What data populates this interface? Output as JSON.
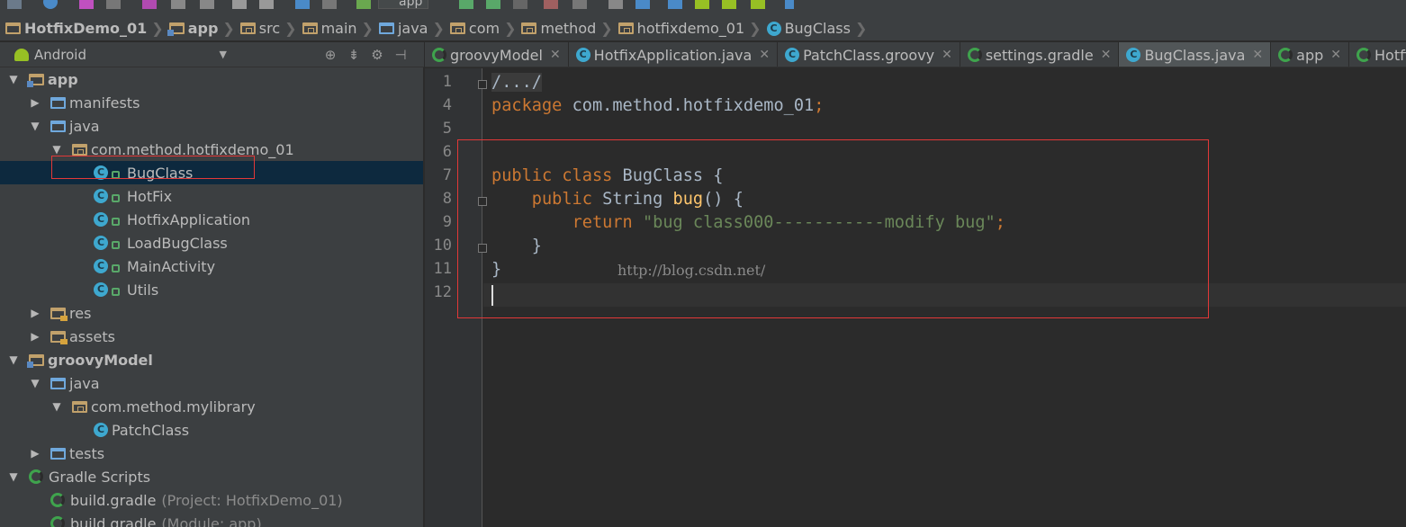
{
  "toolbar": {
    "run_config": "app"
  },
  "breadcrumbs": [
    "HotfixDemo_01",
    "app",
    "src",
    "main",
    "java",
    "com",
    "method",
    "hotfixdemo_01",
    "BugClass"
  ],
  "project_panel": {
    "view_selector": "Android",
    "tree": [
      {
        "label": "app",
        "indent": 0,
        "arrow": "down",
        "icon": "module",
        "bold": true
      },
      {
        "label": "manifests",
        "indent": 1,
        "arrow": "right",
        "icon": "folder-blue"
      },
      {
        "label": "java",
        "indent": 1,
        "arrow": "down",
        "icon": "folder-blue"
      },
      {
        "label": "com.method.hotfixdemo_01",
        "indent": 2,
        "arrow": "down",
        "icon": "package"
      },
      {
        "label": "BugClass",
        "indent": 3,
        "icon": "class",
        "selected": true
      },
      {
        "label": "HotFix",
        "indent": 3,
        "icon": "class"
      },
      {
        "label": "HotfixApplication",
        "indent": 3,
        "icon": "class"
      },
      {
        "label": "LoadBugClass",
        "indent": 3,
        "icon": "class"
      },
      {
        "label": "MainActivity",
        "indent": 3,
        "icon": "class"
      },
      {
        "label": "Utils",
        "indent": 3,
        "icon": "class"
      },
      {
        "label": "res",
        "indent": 1,
        "arrow": "right",
        "icon": "res"
      },
      {
        "label": "assets",
        "indent": 1,
        "arrow": "right",
        "icon": "res"
      },
      {
        "label": "groovyModel",
        "indent": 0,
        "arrow": "down",
        "icon": "module",
        "bold": true
      },
      {
        "label": "java",
        "indent": 1,
        "arrow": "down",
        "icon": "folder-blue"
      },
      {
        "label": "com.method.mylibrary",
        "indent": 2,
        "arrow": "down",
        "icon": "package"
      },
      {
        "label": "PatchClass",
        "indent": 3,
        "icon": "class-plain"
      },
      {
        "label": "tests",
        "indent": 1,
        "arrow": "right",
        "icon": "folder-blue"
      },
      {
        "label": "Gradle Scripts",
        "indent": 0,
        "arrow": "down",
        "icon": "gradle"
      },
      {
        "label": "build.gradle",
        "indent": 1,
        "icon": "gradle",
        "note": "(Project: HotfixDemo_01)"
      },
      {
        "label": "build.gradle",
        "indent": 1,
        "icon": "gradle",
        "note": "(Module: app)"
      }
    ]
  },
  "tabs": [
    {
      "label": "groovyModel",
      "icon": "gradle"
    },
    {
      "label": "HotfixApplication.java",
      "icon": "class"
    },
    {
      "label": "PatchClass.groovy",
      "icon": "class"
    },
    {
      "label": "settings.gradle",
      "icon": "gradle"
    },
    {
      "label": "BugClass.java",
      "icon": "class",
      "active": true
    },
    {
      "label": "app",
      "icon": "gradle"
    },
    {
      "label": "HotfixDe",
      "icon": "gradle"
    }
  ],
  "editor": {
    "line_numbers": [
      "1",
      "4",
      "5",
      "6",
      "7",
      "8",
      "9",
      "10",
      "11",
      "12"
    ],
    "lines": [
      [
        [
          "folded",
          "/.../"
        ]
      ],
      [
        [
          "kw",
          "package"
        ],
        [
          "plain",
          " com.method.hotfixdemo_01"
        ],
        [
          "kw",
          ";"
        ]
      ],
      [],
      [],
      [
        [
          "kw",
          "public class"
        ],
        [
          "plain",
          " BugClass {"
        ]
      ],
      [
        [
          "plain",
          "    "
        ],
        [
          "kw",
          "public"
        ],
        [
          "plain",
          " String "
        ],
        [
          "fn",
          "bug"
        ],
        [
          "plain",
          "() {"
        ]
      ],
      [
        [
          "plain",
          "        "
        ],
        [
          "kw",
          "return "
        ],
        [
          "str",
          "\"bug class000-----------modify bug\""
        ],
        [
          "kw",
          ";"
        ]
      ],
      [
        [
          "plain",
          "    }"
        ]
      ],
      [
        [
          "plain",
          "}"
        ]
      ],
      []
    ],
    "watermark": "http://blog.csdn.net/"
  }
}
